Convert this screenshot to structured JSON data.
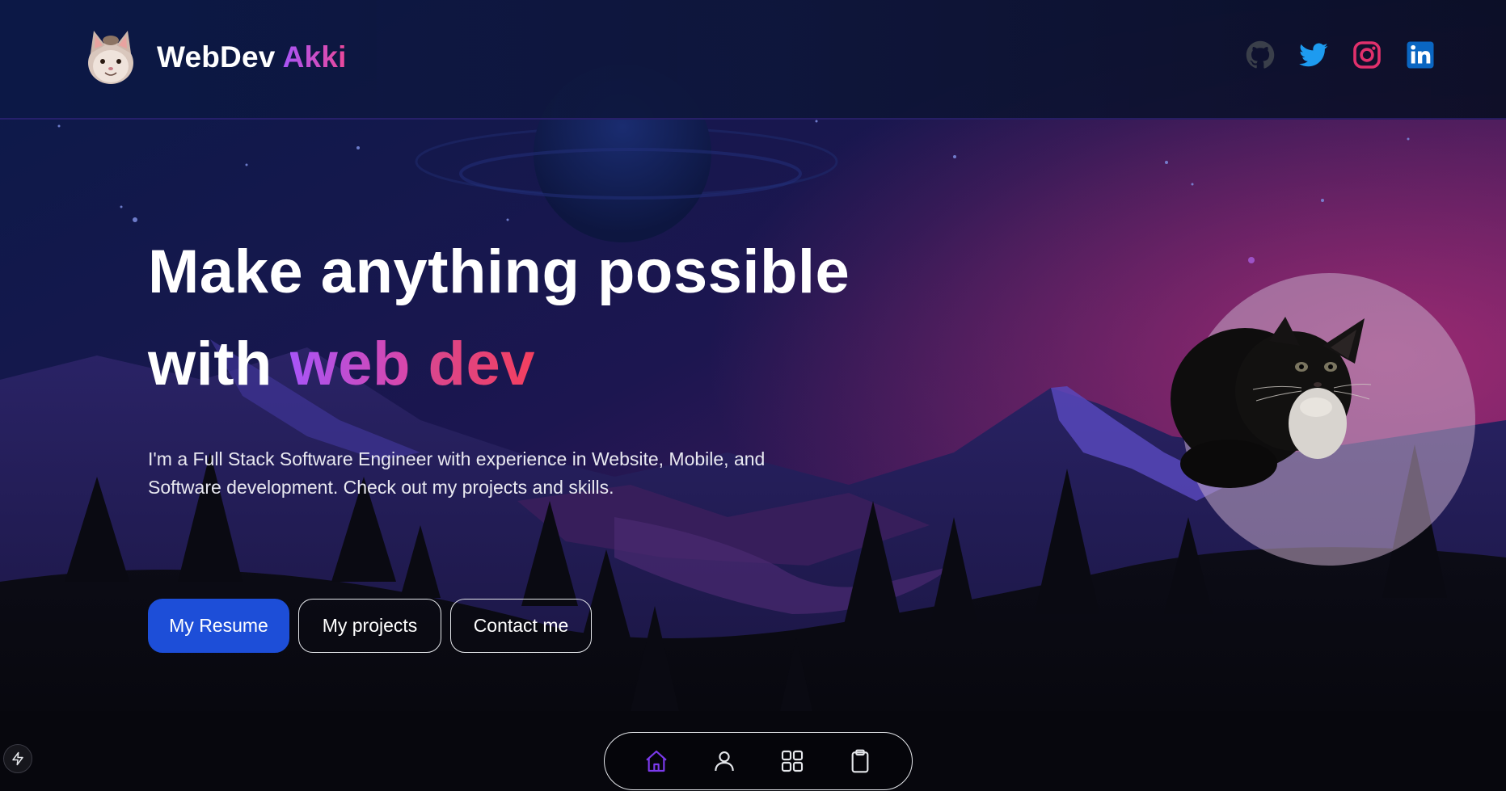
{
  "header": {
    "brand_name": "WebDev",
    "brand_accent": "Akki",
    "socials": [
      "github-icon",
      "twitter-icon",
      "instagram-icon",
      "linkedin-icon"
    ]
  },
  "hero": {
    "title_line1": "Make anything possible",
    "title_line2_prefix": "with",
    "title_accent_1": "web",
    "title_accent_2": "dev",
    "description": "I'm a Full Stack Software Engineer with experience in Website, Mobile, and Software development. Check out my projects and skills."
  },
  "buttons": {
    "resume": "My Resume",
    "projects": "My projects",
    "contact": "Contact me"
  },
  "bottom_nav": {
    "items": [
      "home-icon",
      "user-icon",
      "grid-icon",
      "clipboard-icon"
    ],
    "active": "home-icon"
  },
  "colors": {
    "primary_button": "#1d4ed8",
    "accent_purple": "#a855f7",
    "accent_pink": "#ec4899",
    "twitter": "#1d9bf0",
    "instagram": "#e1306c",
    "linkedin": "#0a66c2",
    "nav_active": "#7c3aed"
  }
}
